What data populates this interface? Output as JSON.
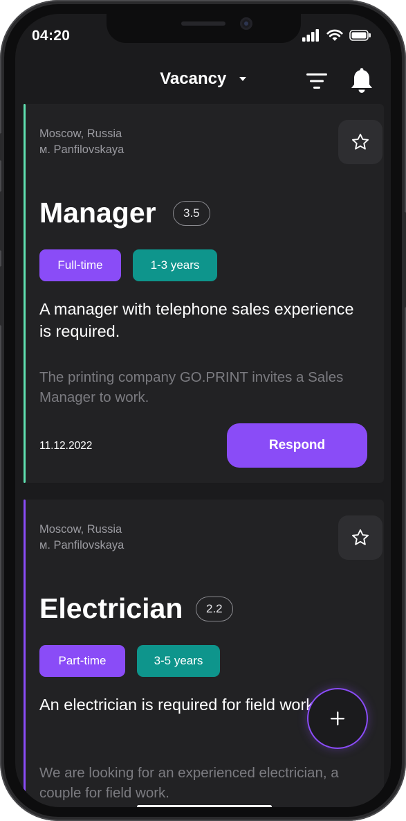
{
  "status_bar": {
    "time": "04:20",
    "icons": [
      "cellular-signal-icon",
      "wifi-icon",
      "battery-icon"
    ]
  },
  "header": {
    "title": "Vacancy",
    "icons": [
      "caret-down-icon",
      "filter-icon",
      "bell-icon"
    ]
  },
  "vacancies": [
    {
      "location_city": "Moscow, Russia",
      "location_metro": "м. Panfilovskaya",
      "title": "Manager",
      "rating": "3.5",
      "employment_type": "Full-time",
      "experience": "1-3 years",
      "headline": "A manager with telephone sales experience is required.",
      "description": "The printing company GO.PRINT invites a Sales Manager to work.",
      "date": "11.12.2022",
      "respond_label": "Respond",
      "accent_color": "#5fe0b0"
    },
    {
      "location_city": "Moscow, Russia",
      "location_metro": "м. Panfilovskaya",
      "title": "Electrician",
      "rating": "2.2",
      "employment_type": "Part-time",
      "experience": "3-5 years",
      "headline": "An electrician is required for field work.",
      "description": "We are looking for an experienced electrician, a couple for field work.",
      "accent_color": "#8a4cf7"
    }
  ],
  "fab": {
    "icon": "plus-icon"
  },
  "colors": {
    "accent_purple": "#8a4cf7",
    "accent_teal": "#0e958c",
    "background": "#1b1b1d",
    "card": "#222224"
  }
}
